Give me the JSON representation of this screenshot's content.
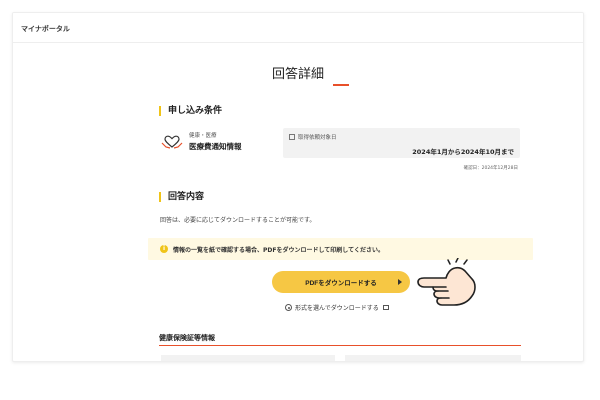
{
  "header": {
    "brand": "マイナポータル"
  },
  "page": {
    "title": "回答詳細"
  },
  "application_conditions": {
    "heading": "申し込み条件",
    "category_sub": "健康・医療",
    "category_main": "医療費通知情報",
    "date_label": "取得依頼対象日",
    "date_value": "2024年1月から2024年10月まで",
    "confirm_date": "確認日：2024年12月28日"
  },
  "answer": {
    "heading": "回答内容",
    "description": "回答は、必要に応じてダウンロードすることが可能です。",
    "notice": "情報の一覧を紙で確認する場合、PDFをダウンロードして印刷してください。",
    "pdf_button": "PDFをダウンロードする",
    "format_link": "形式を選んでダウンロードする"
  },
  "insurance": {
    "heading": "健康保険証等情報"
  },
  "colors": {
    "accent_orange": "#e8502a",
    "accent_yellow": "#f0c419",
    "button_yellow": "#f6c744",
    "notice_bg": "#fff9e2"
  }
}
